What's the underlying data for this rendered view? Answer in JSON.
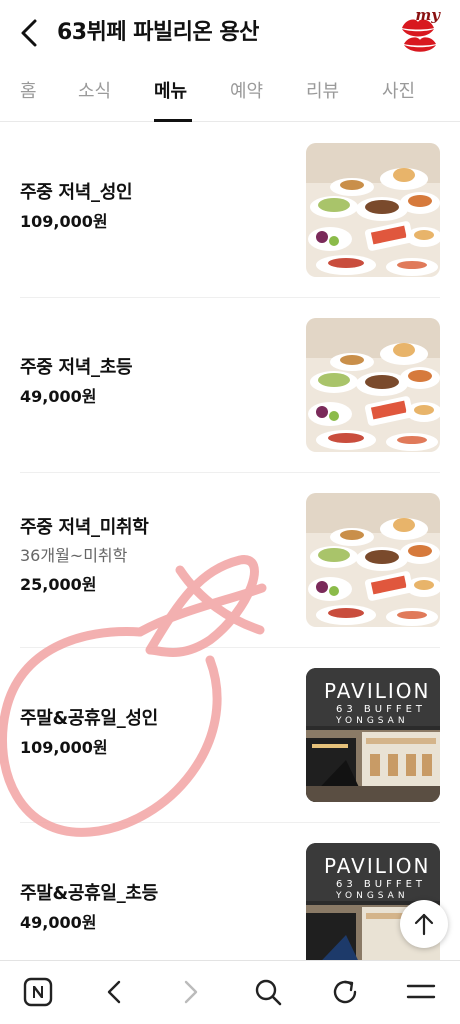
{
  "header": {
    "title": "63뷔페 파빌리온 용산",
    "my_badge": "my"
  },
  "tabs": [
    {
      "label": "홈"
    },
    {
      "label": "소식"
    },
    {
      "label": "메뉴",
      "active": true
    },
    {
      "label": "예약"
    },
    {
      "label": "리뷰"
    },
    {
      "label": "사진"
    }
  ],
  "menu": [
    {
      "name": "주중 저녁_성인",
      "price": "109,000원",
      "image": "buffet-food"
    },
    {
      "name": "주중 저녁_초등",
      "price": "49,000원",
      "image": "buffet-food"
    },
    {
      "name": "주중 저녁_미취학",
      "desc": "36개월~미취학",
      "price": "25,000원",
      "image": "buffet-food"
    },
    {
      "name": "주말&공휴일_성인",
      "price": "109,000원",
      "image": "pavilion-entrance"
    },
    {
      "name": "주말&공휴일_초등",
      "price": "49,000원",
      "image": "pavilion-entrance"
    }
  ],
  "signage": {
    "line1": "PAVILION",
    "line2": "63 BUFFET",
    "line3": "YONGSAN"
  },
  "colors": {
    "accent": "#111111",
    "inactive_tab": "#9a9a9a",
    "doodle": "#f2a3a3",
    "lips": "#d8181f"
  },
  "icons": {
    "back": "chevron-left-icon",
    "scroll_top": "arrow-up-icon",
    "bottom_nav": [
      "naver-home-icon",
      "back-arrow-icon",
      "forward-arrow-icon",
      "search-icon",
      "refresh-icon",
      "menu-icon"
    ]
  }
}
